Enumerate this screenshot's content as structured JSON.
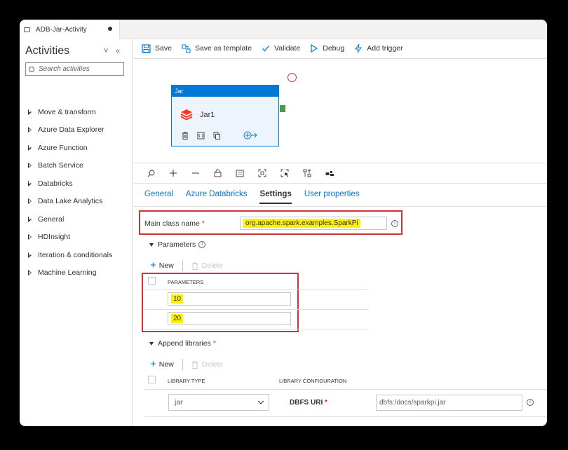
{
  "tab": {
    "title": "ADB-Jar-Activity"
  },
  "sidebar": {
    "title": "Activities",
    "search_placeholder": "Search activities",
    "items": [
      {
        "label": "Move & transform"
      },
      {
        "label": "Azure Data Explorer"
      },
      {
        "label": "Azure Function"
      },
      {
        "label": "Batch Service"
      },
      {
        "label": "Databricks"
      },
      {
        "label": "Data Lake Analytics"
      },
      {
        "label": "General"
      },
      {
        "label": "HDInsight"
      },
      {
        "label": "Iteration & conditionals"
      },
      {
        "label": "Machine Learning"
      }
    ]
  },
  "toolbar": {
    "save": "Save",
    "save_template": "Save as template",
    "validate": "Validate",
    "debug": "Debug",
    "add_trigger": "Add trigger"
  },
  "activity": {
    "header": "Jar",
    "name": "Jar1"
  },
  "tabs": [
    {
      "label": "General"
    },
    {
      "label": "Azure Databricks"
    },
    {
      "label": "Settings"
    },
    {
      "label": "User properties"
    }
  ],
  "settings": {
    "main_class_label": "Main class name",
    "required": "*",
    "main_class_value": "org.apache.spark.examples.SparkPi",
    "parameters_section": "Parameters",
    "new_label": "New",
    "delete_label": "Delete",
    "parameters_header": "PARAMETERS",
    "param_values": [
      "10",
      "20"
    ],
    "append_section": "Append libraries",
    "library_type_header": "LIBRARY TYPE",
    "library_config_header": "LIBRARY CONFIGURATION",
    "library_type_value": "jar",
    "dbfs_label": "DBFS URI",
    "dbfs_value": "dbfs:/docs/sparkpi.jar"
  },
  "colors": {
    "accent": "#0078d4",
    "highlight": "#fff200",
    "callout": "#d13438"
  }
}
